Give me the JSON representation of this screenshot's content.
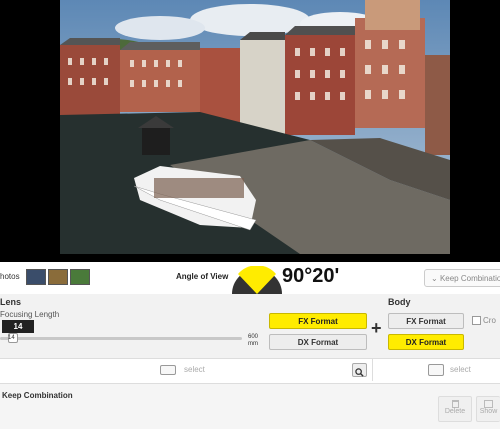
{
  "toolbar": {
    "photos_label": "hotos",
    "angle_of_view_label": "Angle of View",
    "angle_of_view_value": "90°20'",
    "keep_dropdown": "Keep Combinatio"
  },
  "lens": {
    "title": "Lens",
    "focusing_length_label": "Focusing Length",
    "focal_value": "14",
    "slider_min": "14",
    "slider_max": "600",
    "slider_unit": "mm",
    "fx_label": "FX Format",
    "dx_label": "DX Format",
    "fx_selected": true,
    "select_placeholder": "select"
  },
  "body": {
    "title": "Body",
    "fx_label": "FX Format",
    "dx_label": "DX Format",
    "dx_selected": true,
    "crop_label": "Cro",
    "select_placeholder": "select"
  },
  "keep": {
    "title": "Keep Combination",
    "delete_label": "Delete",
    "show_label": "Show"
  },
  "colors": {
    "accent_yellow": "#ffec00",
    "dark": "#222222"
  }
}
